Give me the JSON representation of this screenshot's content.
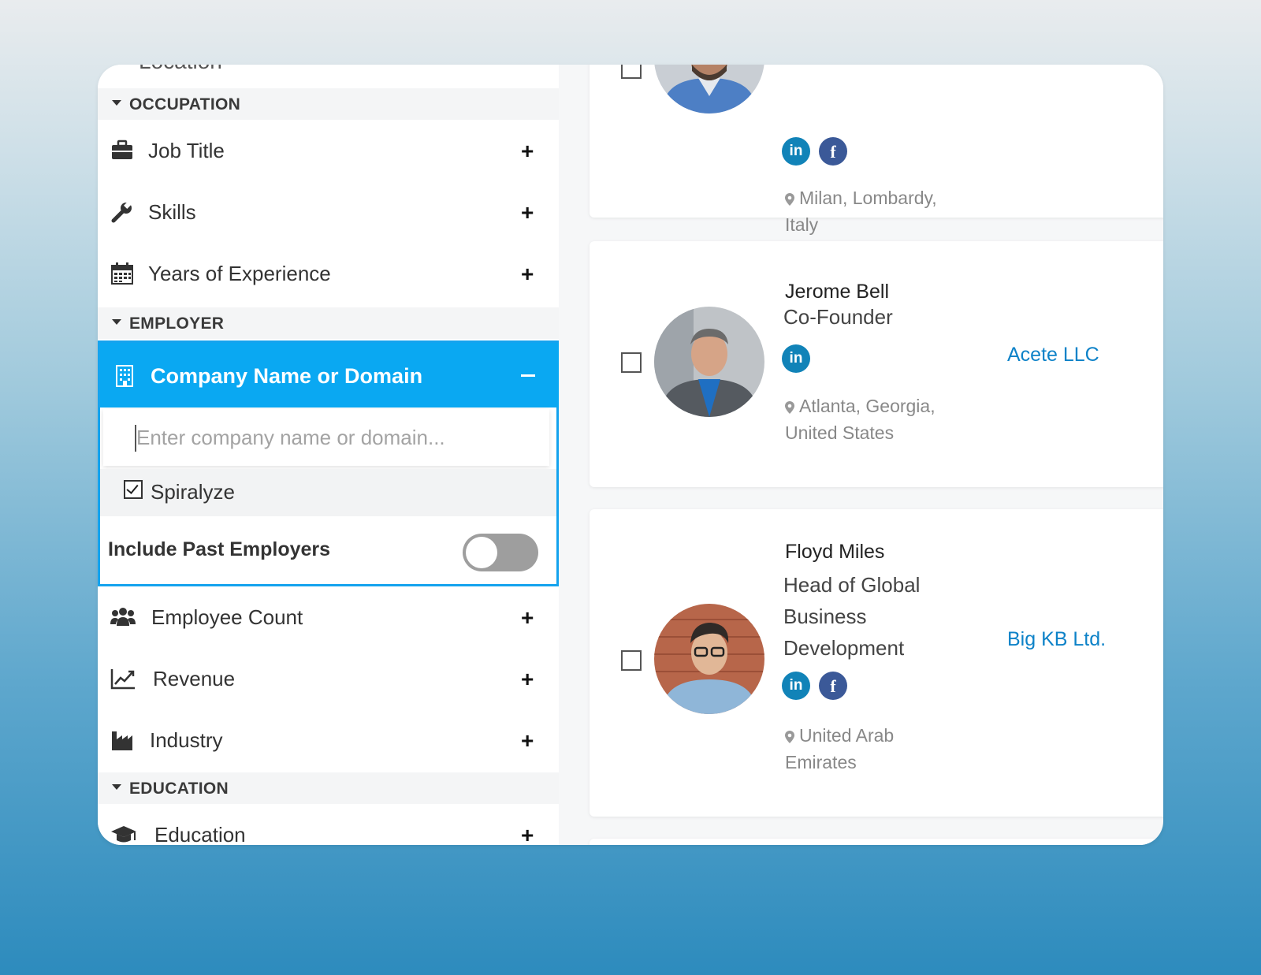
{
  "sidebar": {
    "peek_label": "Location",
    "sections": [
      {
        "title": "OCCUPATION"
      },
      {
        "title": "EMPLOYER"
      },
      {
        "title": "EDUCATION"
      }
    ],
    "items": [
      {
        "label": "Job Title",
        "icon": "briefcase-icon"
      },
      {
        "label": "Skills",
        "icon": "wrench-icon"
      },
      {
        "label": "Years of Experience",
        "icon": "calendar-icon"
      },
      {
        "label": "Employee Count",
        "icon": "users-icon"
      },
      {
        "label": "Revenue",
        "icon": "line-chart-icon"
      },
      {
        "label": "Industry",
        "icon": "factory-icon"
      },
      {
        "label": "Education",
        "icon": "graduation-cap-icon"
      }
    ],
    "plus_symbol": "+",
    "company_filter": {
      "label": "Company Name or Domain",
      "icon": "building-icon",
      "input_placeholder": "Enter company name or domain...",
      "input_value": "",
      "selected_company": "Spiralyze",
      "selected_checked": true,
      "past_employers_label": "Include Past Employers",
      "past_employers_on": false
    }
  },
  "results": [
    {
      "name": "",
      "title": "",
      "location": "Milan, Lombardy, Italy",
      "socials": [
        "linkedin-icon",
        "facebook-icon"
      ],
      "company": ""
    },
    {
      "name": "Jerome Bell",
      "title": "Co-Founder",
      "location": "Atlanta, Georgia, United States",
      "socials": [
        "linkedin-icon"
      ],
      "company": "Acete LLC"
    },
    {
      "name": "Floyd Miles",
      "title": "Head of Global Business Development",
      "location": "United Arab Emirates",
      "socials": [
        "linkedin-icon",
        "facebook-icon"
      ],
      "company": "Big KB Ltd."
    }
  ],
  "social_labels": {
    "linkedin": "in",
    "facebook": "f"
  },
  "colors": {
    "accent": "#0aa8f2",
    "link": "#0d82c8",
    "linkedin": "#1183b8",
    "facebook": "#3b5998"
  }
}
